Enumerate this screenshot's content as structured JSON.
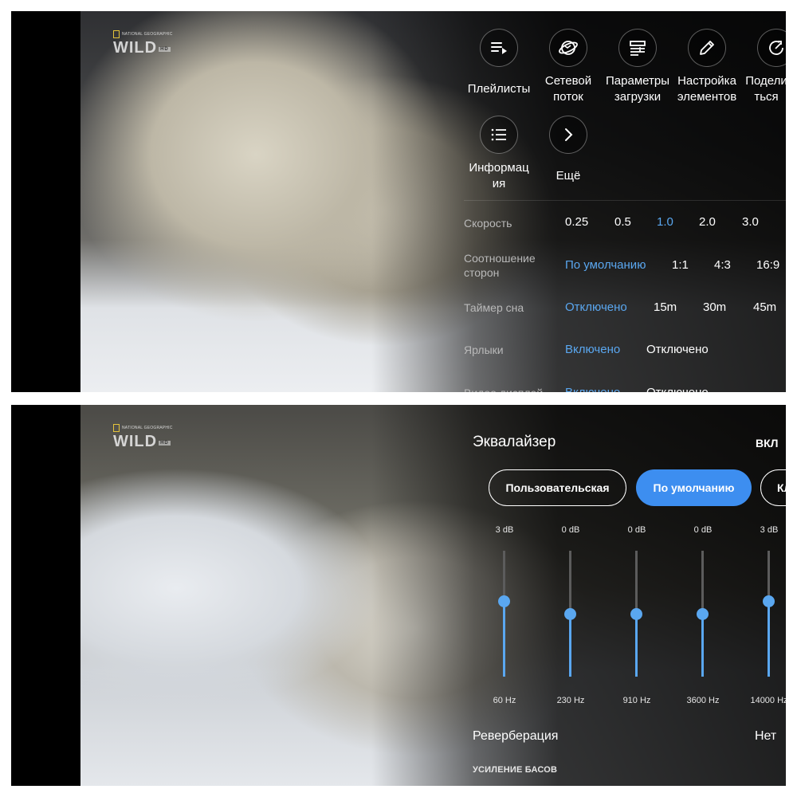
{
  "top_menu": {
    "items": [
      {
        "label": "Плейлисты",
        "icon": "playlist-icon"
      },
      {
        "label": "Сетевой поток",
        "icon": "network-stream-icon"
      },
      {
        "label": "Параметры загрузки",
        "icon": "download-settings-icon"
      },
      {
        "label": "Настройка элементов",
        "icon": "edit-pencil-icon"
      },
      {
        "label": "Поделиться",
        "icon": "share-icon"
      },
      {
        "label": "Информация",
        "icon": "info-list-icon"
      },
      {
        "label": "Ещё",
        "icon": "chevron-right-icon"
      }
    ],
    "speed": {
      "label": "Скорость",
      "options": [
        "0.25",
        "0.5",
        "1.0",
        "2.0",
        "3.0"
      ],
      "selected": "1.0"
    },
    "aspect": {
      "label": "Соотношение сторон",
      "options": [
        "По умолчанию",
        "1:1",
        "4:3",
        "16:9"
      ],
      "selected": "По умолчанию"
    },
    "sleep_timer": {
      "label": "Таймер сна",
      "options": [
        "Отключено",
        "15m",
        "30m",
        "45m"
      ],
      "selected": "Отключено"
    },
    "shortcuts": {
      "label": "Ярлыки",
      "options": [
        "Включено",
        "Отключено"
      ],
      "selected": "Включено"
    },
    "video_display": {
      "label": "Видео дисплей",
      "options": [
        "Включено",
        "Отключено"
      ],
      "selected": "Включено"
    }
  },
  "logo": {
    "small": "NATIONAL GEOGRAPHIC",
    "main": "WILD",
    "badge": "HD"
  },
  "equalizer": {
    "title": "Эквалайзер",
    "state": "ВКЛ",
    "presets": [
      "Пользовательская",
      "По умолчанию",
      "Классика"
    ],
    "selected_preset": "По умолчанию",
    "bands": [
      {
        "freq": "60 Hz",
        "gain": "3 dB",
        "level": 0.6
      },
      {
        "freq": "230 Hz",
        "gain": "0 dB",
        "level": 0.5
      },
      {
        "freq": "910 Hz",
        "gain": "0 dB",
        "level": 0.5
      },
      {
        "freq": "3600 Hz",
        "gain": "0 dB",
        "level": 0.5
      },
      {
        "freq": "14000 Hz",
        "gain": "3 dB",
        "level": 0.6
      }
    ],
    "reverb_label": "Реверберация",
    "reverb_value": "Нет",
    "bass_label": "УСИЛЕНИЕ БАСОВ"
  },
  "colors": {
    "accent": "#5aa7f0",
    "preset_fill": "#3d8ef0"
  }
}
